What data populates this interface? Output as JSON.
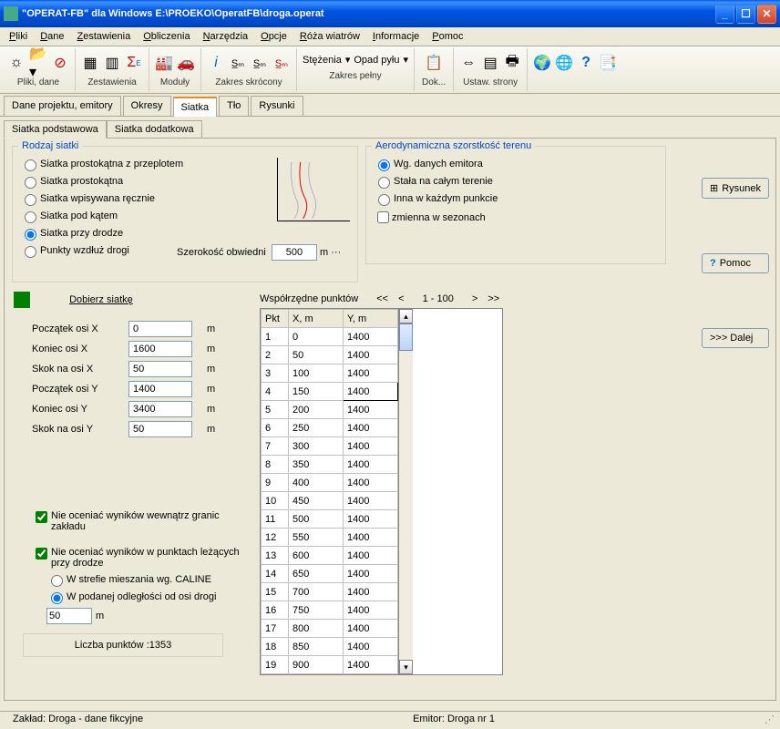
{
  "title": "\"OPERAT-FB\" dla Windows  E:\\PROEKO\\OperatFB\\droga.operat",
  "menu": [
    "Pliki",
    "Dane",
    "Zestawienia",
    "Obliczenia",
    "Narzędzia",
    "Opcje",
    "Róża wiatrów",
    "Informacje",
    "Pomoc"
  ],
  "toolbar_groups": [
    {
      "label": "Pliki, dane"
    },
    {
      "label": "Zestawienia"
    },
    {
      "label": "Moduły"
    },
    {
      "label": "Zakres skrócony"
    },
    {
      "label": "Zakres pełny",
      "items": [
        "Stężenia",
        "Opad pyłu"
      ]
    },
    {
      "label": "Dok..."
    },
    {
      "label": "Ustaw. strony"
    },
    {
      "label": ""
    }
  ],
  "main_tabs": [
    "Dane projektu, emitory",
    "Okresy",
    "Siatka",
    "Tło",
    "Rysunki"
  ],
  "main_tab_active": 2,
  "sub_tabs": [
    "Siatka podstawowa",
    "Siatka dodatkowa"
  ],
  "sub_tab_active": 0,
  "rodzaj": {
    "legend": "Rodzaj siatki",
    "options": [
      "Siatka prostokątna z przeplotem",
      "Siatka prostokątna",
      "Siatka wpisywana ręcznie",
      "Siatka pod kątem",
      "Siatka przy drodze",
      "Punkty wzdłuż drogi"
    ],
    "selected": 4,
    "obwiedni_label": "Szerokość obwiedni",
    "obwiedni_value": "500",
    "obwiedni_unit": "m  ···"
  },
  "aero": {
    "legend": "Aerodynamiczna szorstkość terenu",
    "options": [
      "Wg. danych emitora",
      "Stała na całym terenie",
      "Inna w każdym punkcie"
    ],
    "selected": 0,
    "checkbox": "zmienna w sezonach"
  },
  "dobierz": "Dobierz siatkę",
  "axes": {
    "labels": [
      "Początek osi  X",
      "Koniec osi X",
      "Skok na osi  X",
      "Początek osi Y",
      "Koniec osi Y",
      "Skok na osi Y"
    ],
    "values": [
      "0",
      "1600",
      "50",
      "1400",
      "3400",
      "50"
    ],
    "unit": "m"
  },
  "checks": {
    "c1": "Nie oceniać wyników wewnątrz granic zakładu",
    "c2": "Nie oceniać wyników w punktach leżących przy drodze",
    "r1": "W strefie mieszania wg. CALINE",
    "r2": "W podanej odległości od osi drogi",
    "dist": "50",
    "dist_unit": "m"
  },
  "count": "Liczba punktów :1353",
  "coords": {
    "header": "Współrzędne punktów",
    "range": "1 - 100",
    "cols": [
      "Pkt",
      "X, m",
      "Y, m"
    ],
    "rows": [
      [
        "1",
        "0",
        "1400"
      ],
      [
        "2",
        "50",
        "1400"
      ],
      [
        "3",
        "100",
        "1400"
      ],
      [
        "4",
        "150",
        "1400"
      ],
      [
        "5",
        "200",
        "1400"
      ],
      [
        "6",
        "250",
        "1400"
      ],
      [
        "7",
        "300",
        "1400"
      ],
      [
        "8",
        "350",
        "1400"
      ],
      [
        "9",
        "400",
        "1400"
      ],
      [
        "10",
        "450",
        "1400"
      ],
      [
        "11",
        "500",
        "1400"
      ],
      [
        "12",
        "550",
        "1400"
      ],
      [
        "13",
        "600",
        "1400"
      ],
      [
        "14",
        "650",
        "1400"
      ],
      [
        "15",
        "700",
        "1400"
      ],
      [
        "16",
        "750",
        "1400"
      ],
      [
        "17",
        "800",
        "1400"
      ],
      [
        "18",
        "850",
        "1400"
      ],
      [
        "19",
        "900",
        "1400"
      ]
    ],
    "selected_cell": [
      3,
      2
    ]
  },
  "side": {
    "rysunek": "Rysunek",
    "pomoc": "Pomoc",
    "dalej": ">>> Dalej"
  },
  "status": {
    "left": "Zakład: Droga - dane fikcyjne",
    "right": "Emitor: Droga nr 1"
  }
}
